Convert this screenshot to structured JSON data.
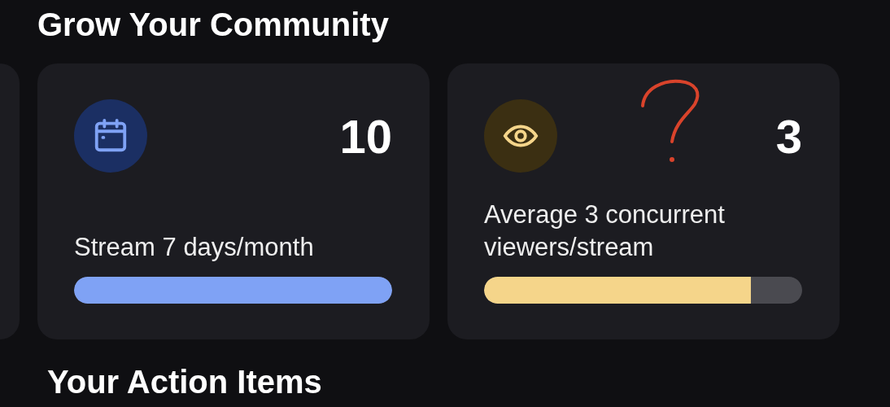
{
  "heading": "Grow Your Community",
  "cards": [
    {
      "kind": "partial"
    },
    {
      "kind": "days",
      "value": "10",
      "label": "Stream 7 days/month",
      "level": 1,
      "color": "#7fa2f5"
    },
    {
      "kind": "viewers",
      "value": "3",
      "label": "Average 3 concurrent viewers/stream",
      "level": 0.84,
      "color": "#f5d58a"
    }
  ],
  "next_heading": "Your Action Items"
}
